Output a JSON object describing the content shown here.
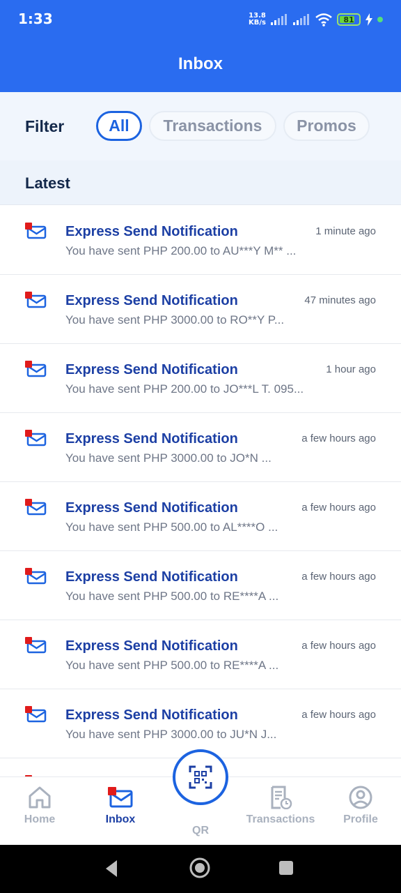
{
  "status_bar": {
    "time": "1:33",
    "net_speed_value": "13.8",
    "net_speed_unit": "KB/s",
    "battery": "81",
    "battery_color": "#6bd63a"
  },
  "app_bar": {
    "title": "Inbox",
    "color": "#2a6cf0"
  },
  "filter": {
    "label": "Filter",
    "chips": [
      {
        "label": "All",
        "active": true
      },
      {
        "label": "Transactions",
        "active": false
      },
      {
        "label": "Promos",
        "active": false
      }
    ]
  },
  "section": {
    "title": "Latest"
  },
  "messages": [
    {
      "icon": "envelope-unread-icon",
      "title": "Express Send Notification",
      "time": "1 minute ago",
      "preview": "You have sent PHP 200.00 to AU***Y M** ..."
    },
    {
      "icon": "envelope-unread-icon",
      "title": "Express Send Notification",
      "time": "47 minutes ago",
      "preview": "You have sent PHP 3000.00 to RO**Y P..."
    },
    {
      "icon": "envelope-unread-icon",
      "title": "Express Send Notification",
      "time": "1 hour ago",
      "preview": "You have sent PHP 200.00 to JO***L T. 095..."
    },
    {
      "icon": "envelope-unread-icon",
      "title": "Express Send Notification",
      "time": "a few hours ago",
      "preview": "You have sent PHP 3000.00 to JO*N ..."
    },
    {
      "icon": "envelope-unread-icon",
      "title": "Express Send Notification",
      "time": "a few hours ago",
      "preview": "You have sent PHP 500.00 to AL****O ..."
    },
    {
      "icon": "envelope-unread-icon",
      "title": "Express Send Notification",
      "time": "a few hours ago",
      "preview": "You have sent PHP 500.00 to RE****A ..."
    },
    {
      "icon": "envelope-unread-icon",
      "title": "Express Send Notification",
      "time": "a few hours ago",
      "preview": "You have sent PHP 500.00 to RE****A ..."
    },
    {
      "icon": "envelope-unread-icon",
      "title": "Express Send Notification",
      "time": "a few hours ago",
      "preview": "You have sent PHP 3000.00 to JU*N J..."
    }
  ],
  "bottom_nav": {
    "items": [
      {
        "label": "Home",
        "icon": "home-icon",
        "active": false
      },
      {
        "label": "Inbox",
        "icon": "inbox-icon",
        "active": true
      },
      {
        "label": "QR",
        "icon": "qr-scan-icon",
        "active": false
      },
      {
        "label": "Transactions",
        "icon": "receipt-icon",
        "active": false
      },
      {
        "label": "Profile",
        "icon": "profile-icon",
        "active": false
      }
    ],
    "active_color": "#1c3fa4",
    "inactive_color": "#a9b1be"
  },
  "colors": {
    "accent": "#1c63e0",
    "unread_marker": "#e01b1b"
  }
}
